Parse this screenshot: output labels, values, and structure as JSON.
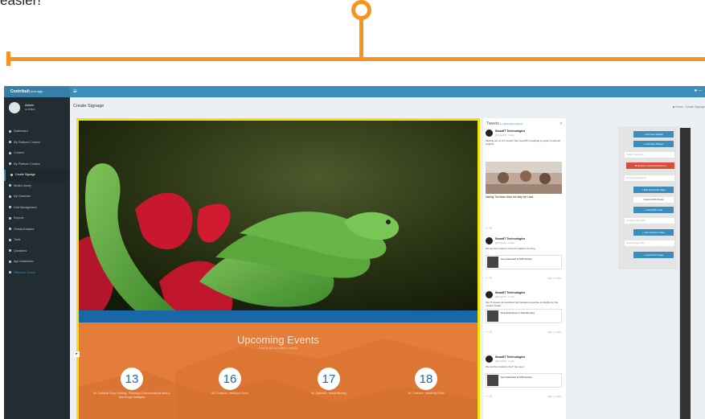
{
  "caption": "easier!",
  "app": {
    "brand": "ContribuIt",
    "brand_suffix": "tech login",
    "sidebar": {
      "user_name": "Admin",
      "user_status": "● online",
      "items": [
        {
          "label": "Dashboard",
          "active": false
        },
        {
          "label": "My Platform Content",
          "active": false
        },
        {
          "label": "Content",
          "active": false
        },
        {
          "label": "My Platform Content",
          "active": false
        },
        {
          "label": "Create Signage",
          "active": true
        },
        {
          "label": "Media Library",
          "active": false
        },
        {
          "label": "My Channels",
          "active": false
        },
        {
          "label": "Link Management",
          "active": false
        },
        {
          "label": "Reports",
          "active": false
        },
        {
          "label": "Global Analytics",
          "active": false
        },
        {
          "label": "Tools",
          "active": false
        },
        {
          "label": "Questions",
          "active": false
        },
        {
          "label": "App Installation",
          "active": false
        },
        {
          "label": "Welcome Screen",
          "active": false,
          "link": true
        }
      ]
    },
    "page_title": "Create Signage",
    "breadcrumb": "◆ Home › Create Signage",
    "signage": {
      "events_title": "Upcoming Events",
      "events_subtitle": "Click to add an event or activity",
      "dates": [
        {
          "day": "13",
          "caption": "Mr. ContribuIt Group Meeting - Planning & Communications Ideas & New Design Strategies"
        },
        {
          "day": "16",
          "caption": "Mr. ContribuIt - Meeting & Event"
        },
        {
          "day": "17",
          "caption": "Mr. ContribuIt - Annual Meeting"
        },
        {
          "day": "18",
          "caption": "Mr. ContribuIt - Marketing Event"
        }
      ]
    },
    "tweets": {
      "title": "Tweets",
      "handle": "by @SmartContribuIt",
      "items": [
        {
          "name": "SmartIT Technologies",
          "handle": "@SmartIT - 3 Jan",
          "text": "Missing out on IoT trends? Get SmartIT's roadmap & expert ContribuIt insights."
        },
        {
          "name": "SmartIT Technologies",
          "handle": "@SmartIT - 3 Jan",
          "text": "We are the creators of the IoT platform for free."
        },
        {
          "name": "SmartIT Technologies",
          "handle": "@SmartIT - 3 Jan",
          "text": "Top IT experts & ContribuIt Technologies expertise & insights for the modern leader."
        },
        {
          "name": "SmartIT Technologies",
          "handle": "@SmartIT - 3 Jan",
          "text": "We are the creators of IoT. Go see it."
        }
      ],
      "big_title": "Making The Brain Work the Way We Lead",
      "cards": [
        "Get Download of IOB Partner",
        "How Enterprise is Transforming",
        "Get Download of IOB Partner"
      ],
      "dates": [
        "May 3, 2016",
        "May 3, 2016",
        "May 3, 2016"
      ]
    },
    "controls": {
      "buttons": [
        "+ Add Text Widget",
        "+ Add New Widget",
        "+ Add Facebook Page",
        "+ Add RSS Feed",
        "+ Add Youtube Video",
        "+ Add Photo Page"
      ],
      "delete_button": "✖ Remove Selected Element",
      "inputs": [
        "Twitter Username",
        "Facebook page link",
        "Insert RSS Feeds",
        "Youtube video URL",
        "Search Page URL"
      ],
      "rss_label": "Custom RSS Feeds"
    }
  }
}
